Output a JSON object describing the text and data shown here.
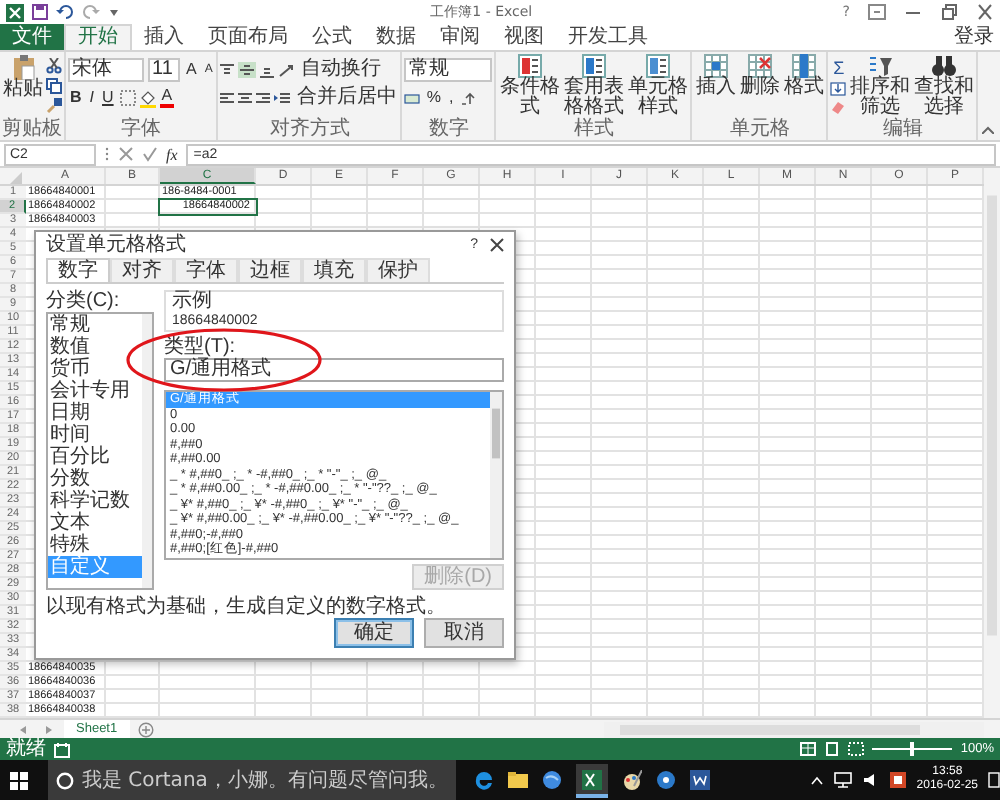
{
  "window": {
    "title": "工作簿1 - Excel",
    "help": "?"
  },
  "ribbon_tabs": [
    {
      "label": "文件",
      "kind": "file",
      "selected": false
    },
    {
      "label": "开始",
      "kind": "tab",
      "selected": true
    },
    {
      "label": "插入",
      "kind": "tab",
      "selected": false
    },
    {
      "label": "页面布局",
      "kind": "tab",
      "selected": false
    },
    {
      "label": "公式",
      "kind": "tab",
      "selected": false
    },
    {
      "label": "数据",
      "kind": "tab",
      "selected": false
    },
    {
      "label": "审阅",
      "kind": "tab",
      "selected": false
    },
    {
      "label": "视图",
      "kind": "tab",
      "selected": false
    },
    {
      "label": "开发工具",
      "kind": "tab",
      "selected": false
    }
  ],
  "account": "登录",
  "ribbon": {
    "clipboard": {
      "label": "剪贴板",
      "paste": "粘贴"
    },
    "font": {
      "label": "字体",
      "name": "宋体",
      "size": "11",
      "grow": "A",
      "shrink": "A",
      "bold": "B",
      "italic": "I",
      "underline": "U",
      "font_color": "A"
    },
    "alignment": {
      "label": "对齐方式",
      "wrap": "自动换行",
      "merge": "合并后居中"
    },
    "number": {
      "label": "数字",
      "format": "常规",
      "percent": "%",
      "comma": ","
    },
    "styles": {
      "label": "样式",
      "buttons": [
        "条件格式",
        "套用表格格式",
        "单元格样式"
      ]
    },
    "cells": {
      "label": "单元格",
      "buttons": [
        "插入",
        "删除",
        "格式"
      ]
    },
    "editing": {
      "label": "编辑",
      "sum": "Σ",
      "buttons": [
        "排序和筛选",
        "查找和选择"
      ]
    }
  },
  "formula_bar": {
    "name_box": "C2",
    "function_label": "fx",
    "formula": "=a2"
  },
  "sheet": {
    "columns": [
      {
        "label": "A",
        "selected": false
      },
      {
        "label": "B",
        "selected": false
      },
      {
        "label": "C",
        "selected": true
      },
      {
        "label": "D",
        "selected": false
      },
      {
        "label": "E",
        "selected": false
      },
      {
        "label": "F",
        "selected": false
      },
      {
        "label": "G",
        "selected": false
      },
      {
        "label": "H",
        "selected": false
      },
      {
        "label": "I",
        "selected": false
      },
      {
        "label": "J",
        "selected": false
      },
      {
        "label": "K",
        "selected": false
      },
      {
        "label": "L",
        "selected": false
      },
      {
        "label": "M",
        "selected": false
      },
      {
        "label": "N",
        "selected": false
      },
      {
        "label": "O",
        "selected": false
      },
      {
        "label": "P",
        "selected": false
      }
    ],
    "rows": [
      {
        "number": "1",
        "selected": false,
        "a": {
          "text": "18664840001",
          "kind": "text",
          "selected": false
        },
        "c": {
          "text": "186-8484-0001",
          "kind": "text",
          "selected": false
        }
      },
      {
        "number": "2",
        "selected": true,
        "a": {
          "text": "18664840002",
          "kind": "text",
          "selected": false
        },
        "c": {
          "text": "18664840002",
          "kind": "number",
          "selected": true
        }
      },
      {
        "number": "3",
        "selected": false,
        "a": {
          "text": "18664840003",
          "kind": "text",
          "selected": false
        }
      },
      {
        "number": "4",
        "selected": false
      },
      {
        "number": "5",
        "selected": false
      },
      {
        "number": "6",
        "selected": false
      },
      {
        "number": "7",
        "selected": false
      },
      {
        "number": "8",
        "selected": false
      },
      {
        "number": "9",
        "selected": false
      },
      {
        "number": "10",
        "selected": false
      },
      {
        "number": "11",
        "selected": false
      },
      {
        "number": "12",
        "selected": false
      },
      {
        "number": "13",
        "selected": false
      },
      {
        "number": "14",
        "selected": false
      },
      {
        "number": "15",
        "selected": false
      },
      {
        "number": "16",
        "selected": false
      },
      {
        "number": "17",
        "selected": false
      },
      {
        "number": "18",
        "selected": false
      },
      {
        "number": "19",
        "selected": false
      },
      {
        "number": "20",
        "selected": false
      },
      {
        "number": "21",
        "selected": false
      },
      {
        "number": "22",
        "selected": false
      },
      {
        "number": "23",
        "selected": false
      },
      {
        "number": "24",
        "selected": false
      },
      {
        "number": "25",
        "selected": false
      },
      {
        "number": "26",
        "selected": false
      },
      {
        "number": "27",
        "selected": false
      },
      {
        "number": "28",
        "selected": false
      },
      {
        "number": "29",
        "selected": false
      },
      {
        "number": "30",
        "selected": false
      },
      {
        "number": "31",
        "selected": false
      },
      {
        "number": "32",
        "selected": false
      },
      {
        "number": "33",
        "selected": false
      },
      {
        "number": "34",
        "selected": false
      },
      {
        "number": "35",
        "selected": false,
        "a": {
          "text": "18664840035",
          "kind": "text",
          "selected": false
        }
      },
      {
        "number": "36",
        "selected": false,
        "a": {
          "text": "18664840036",
          "kind": "text",
          "selected": false
        }
      },
      {
        "number": "37",
        "selected": false,
        "a": {
          "text": "18664840037",
          "kind": "text",
          "selected": false
        }
      },
      {
        "number": "38",
        "selected": false,
        "a": {
          "text": "18664840038",
          "kind": "text",
          "selected": false
        }
      }
    ]
  },
  "dialog": {
    "title": "设置单元格格式",
    "help": "?",
    "tabs": [
      {
        "label": "数字",
        "selected": true
      },
      {
        "label": "对齐",
        "selected": false
      },
      {
        "label": "字体",
        "selected": false
      },
      {
        "label": "边框",
        "selected": false
      },
      {
        "label": "填充",
        "selected": false
      },
      {
        "label": "保护",
        "selected": false
      }
    ],
    "category_label": "分类(C):",
    "categories": [
      {
        "label": "常规",
        "selected": false
      },
      {
        "label": "数值",
        "selected": false
      },
      {
        "label": "货币",
        "selected": false
      },
      {
        "label": "会计专用",
        "selected": false
      },
      {
        "label": "日期",
        "selected": false
      },
      {
        "label": "时间",
        "selected": false
      },
      {
        "label": "百分比",
        "selected": false
      },
      {
        "label": "分数",
        "selected": false
      },
      {
        "label": "科学记数",
        "selected": false
      },
      {
        "label": "文本",
        "selected": false
      },
      {
        "label": "特殊",
        "selected": false
      },
      {
        "label": "自定义",
        "selected": true
      }
    ],
    "sample_label": "示例",
    "sample": "18664840002",
    "type_label": "类型(T):",
    "type_value": "G/通用格式",
    "formats": [
      {
        "label": "G/通用格式",
        "selected": true
      },
      {
        "label": "0",
        "selected": false
      },
      {
        "label": "0.00",
        "selected": false
      },
      {
        "label": "#,##0",
        "selected": false
      },
      {
        "label": "#,##0.00",
        "selected": false
      },
      {
        "label": "_ * #,##0_ ;_ * -#,##0_ ;_ * \"-\"_ ;_ @_ ",
        "selected": false
      },
      {
        "label": "_ * #,##0.00_ ;_ * -#,##0.00_ ;_ * \"-\"??_ ;_ @_ ",
        "selected": false
      },
      {
        "label": "_ ¥* #,##0_ ;_ ¥* -#,##0_ ;_ ¥* \"-\"_ ;_ @_ ",
        "selected": false
      },
      {
        "label": "_ ¥* #,##0.00_ ;_ ¥* -#,##0.00_ ;_ ¥* \"-\"??_ ;_ @_ ",
        "selected": false
      },
      {
        "label": "#,##0;-#,##0",
        "selected": false
      },
      {
        "label": "#,##0;[红色]-#,##0",
        "selected": false
      }
    ],
    "delete_button": {
      "label": "删除(D)",
      "disabled": true
    },
    "description": "以现有格式为基础，生成自定义的数字格式。",
    "buttons": [
      {
        "label": "确定",
        "default": true
      },
      {
        "label": "取消",
        "default": false
      }
    ]
  },
  "sheet_tabs": [
    {
      "label": "Sheet1",
      "selected": true
    }
  ],
  "status_bar": {
    "status": "就绪",
    "zoom": "100%",
    "zoom_level": {
      "level": 0.5
    }
  },
  "taskbar": {
    "search_placeholder": "我是 Cortana，小娜。有问题尽管问我。",
    "time": "13:58",
    "date": "2016-02-25"
  }
}
